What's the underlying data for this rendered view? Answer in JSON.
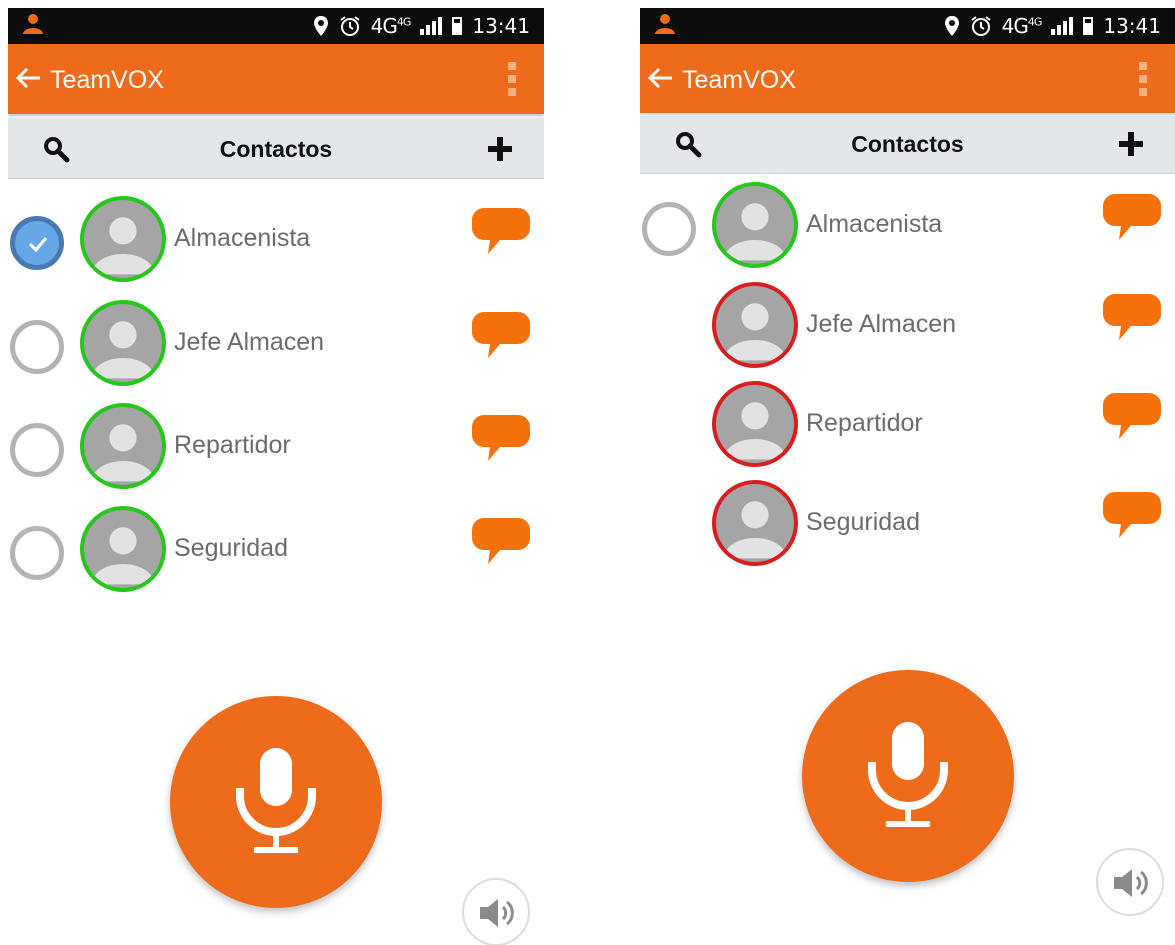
{
  "status_bar": {
    "time": "13:41",
    "network": "4G",
    "network_sub": "4G"
  },
  "app": {
    "title": "TeamVOX"
  },
  "subbar": {
    "title": "Contactos"
  },
  "screens": [
    {
      "contacts": [
        {
          "name": "Almacenista",
          "selected": true,
          "status": "online"
        },
        {
          "name": "Jefe Almacen",
          "selected": false,
          "status": "online"
        },
        {
          "name": "Repartidor",
          "selected": false,
          "status": "online"
        },
        {
          "name": "Seguridad",
          "selected": false,
          "status": "online"
        }
      ]
    },
    {
      "contacts": [
        {
          "name": "Almacenista",
          "selected": false,
          "status": "online"
        },
        {
          "name": "Jefe Almacen",
          "selected": null,
          "status": "offline"
        },
        {
          "name": "Repartidor",
          "selected": null,
          "status": "offline"
        },
        {
          "name": "Seguridad",
          "selected": null,
          "status": "offline"
        }
      ]
    }
  ],
  "colors": {
    "accent": "#ee6b1b",
    "online": "#27c51e",
    "offline": "#d81f1f",
    "selected": "#66a7e6"
  },
  "icons": [
    "back-arrow-icon",
    "overflow-menu-icon",
    "search-icon",
    "add-icon",
    "chat-bubble-icon",
    "microphone-icon",
    "speaker-icon",
    "check-icon",
    "person-icon"
  ]
}
